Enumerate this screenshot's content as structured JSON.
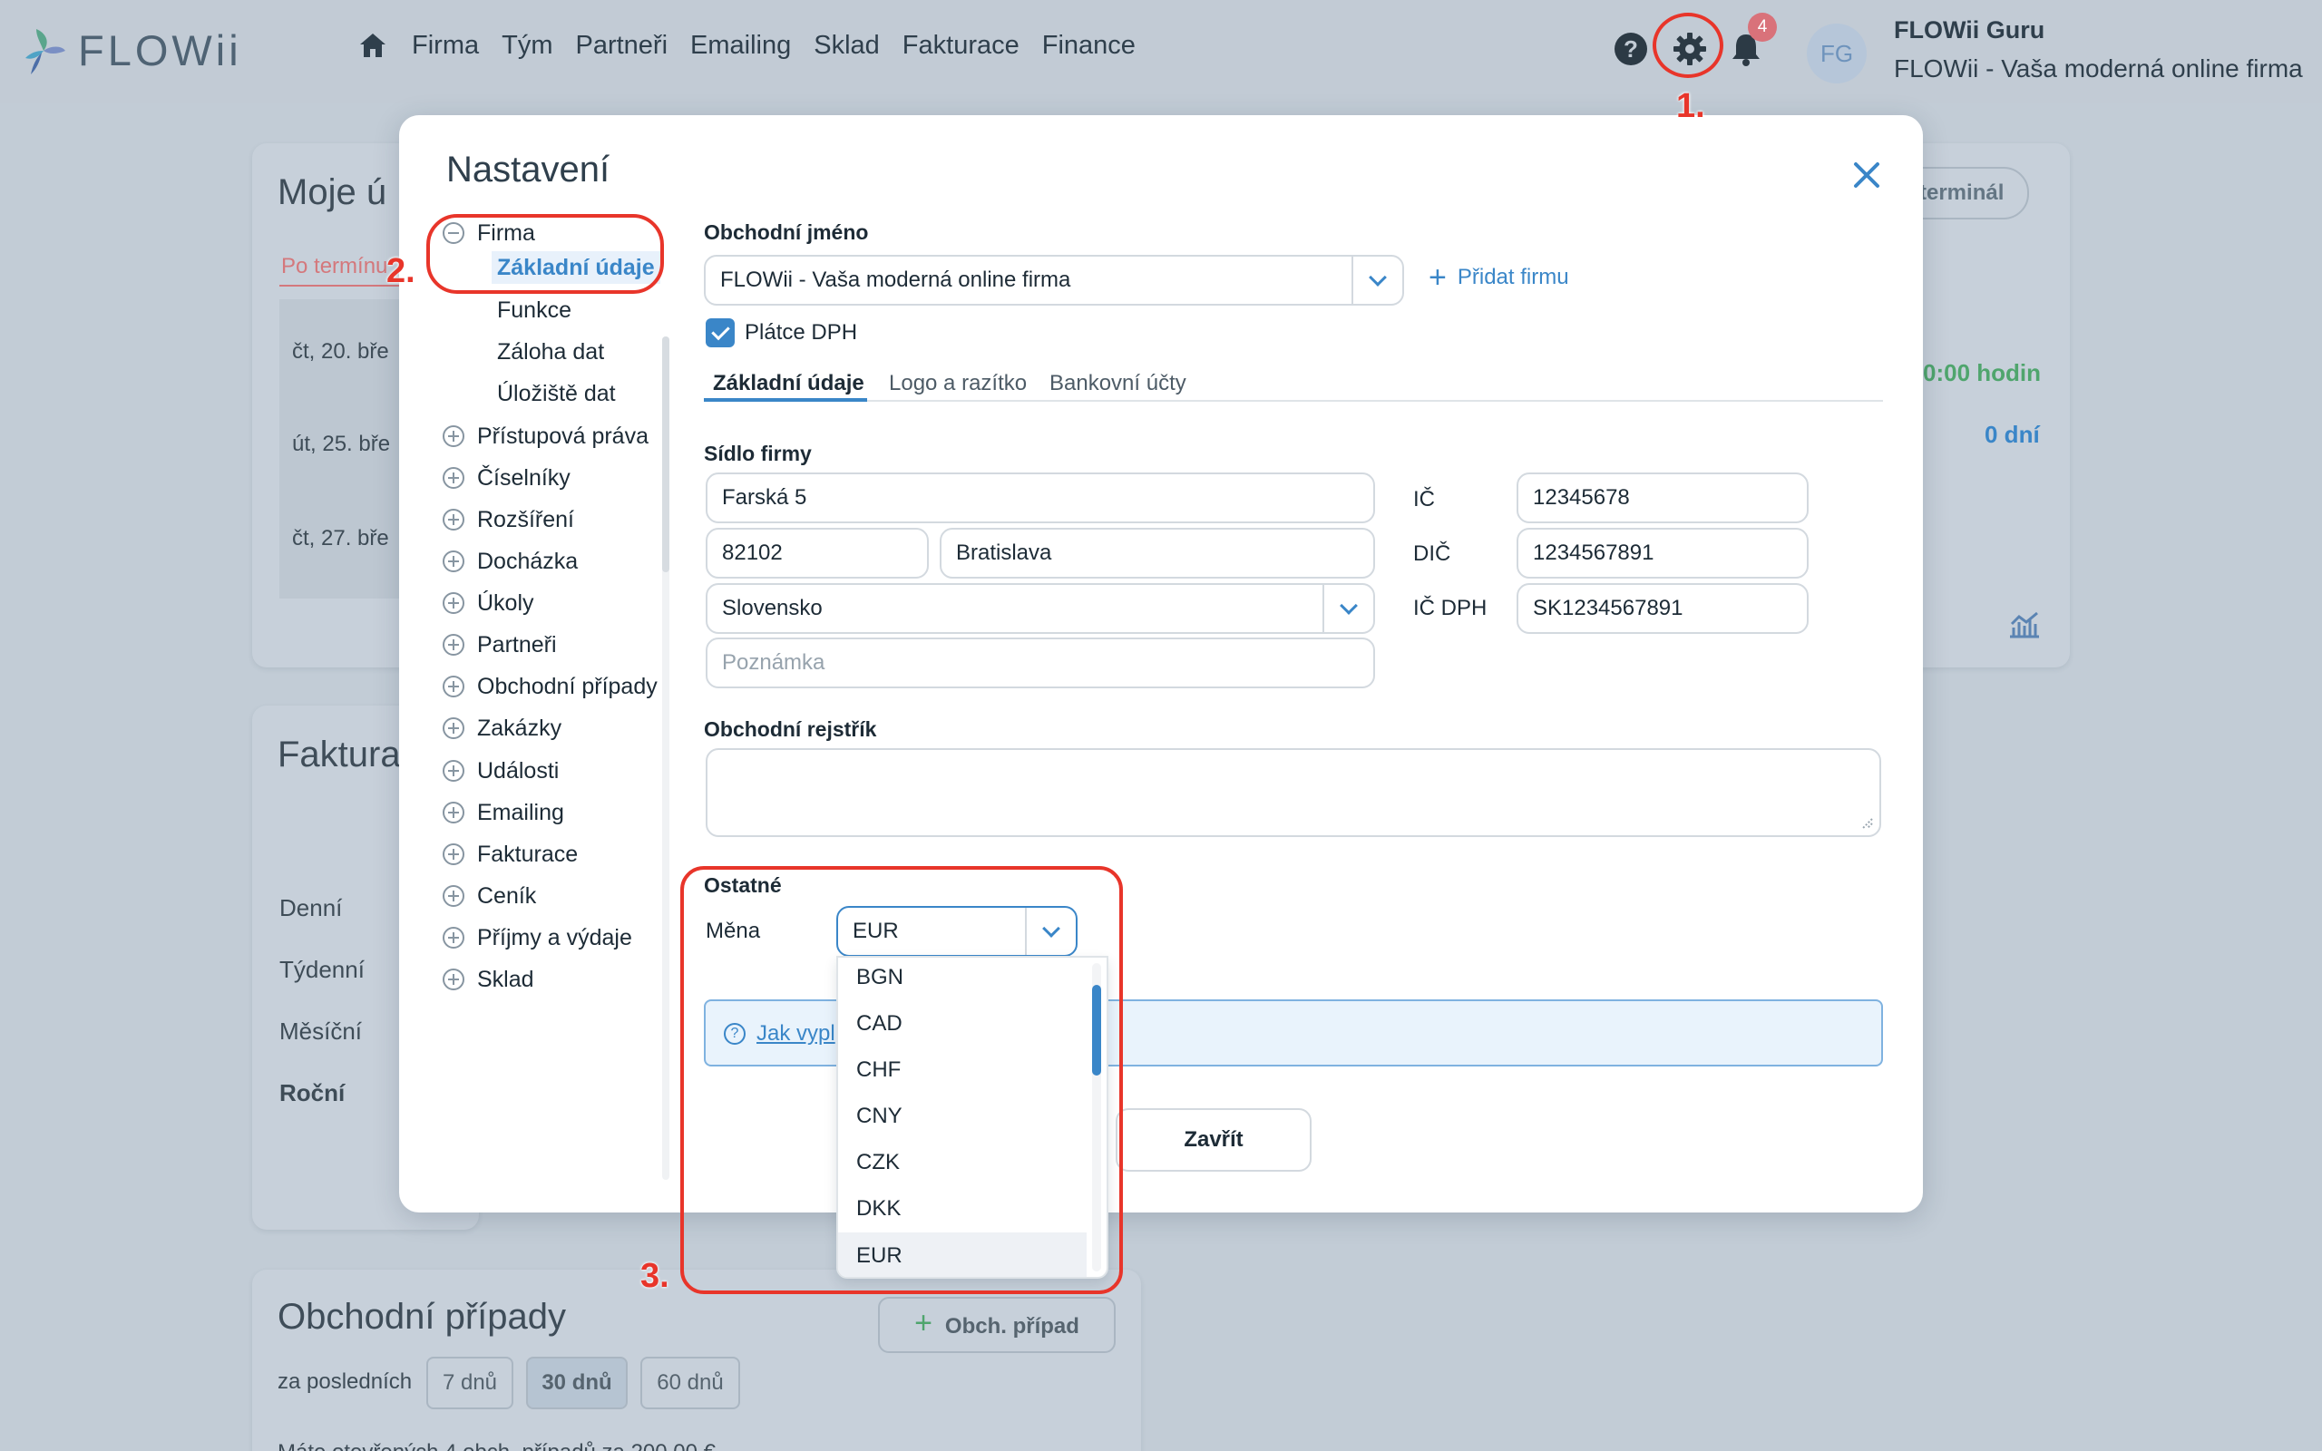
{
  "app": {
    "logo_text": "FLOWii"
  },
  "nav": {
    "items": [
      "Firma",
      "Tým",
      "Partneři",
      "Emailing",
      "Sklad",
      "Fakturace",
      "Finance"
    ]
  },
  "topbar": {
    "notifications_count": "4",
    "avatar_initials": "FG",
    "user_name": "FLOWii Guru",
    "user_company": "FLOWii - Vaša moderná online firma",
    "help_label": "?"
  },
  "background": {
    "card1_title": "Moje ú",
    "card1_filter": "Po termínu",
    "card1_rows": [
      "čt, 20. bře",
      "út, 25. bře",
      "čt, 27. bře"
    ],
    "card1_terminal": "terminál",
    "card1_hours": "0:00 hodin",
    "card1_days": "0 dní",
    "card2_title": "Faktura",
    "card2_rows": [
      "Denní",
      "Týdenní",
      "Měsíční",
      "Roční"
    ],
    "card3_title": "Obchodní případy",
    "card3_button": "Obch. případ",
    "card3_period_label": "za posledních",
    "card3_periods": [
      "7 dnů",
      "30 dnů",
      "60 dnů"
    ],
    "card3_footer": "Máte otevřených 4 obch. případů za 200,00 €"
  },
  "modal": {
    "title": "Nastavení",
    "tree": {
      "root": "Firma",
      "children": [
        "Základní údaje",
        "Funkce",
        "Záloha dat",
        "Úložiště dat"
      ],
      "sections": [
        "Přístupová práva",
        "Číselníky",
        "Rozšíření",
        "Docházka",
        "Úkoly",
        "Partneři",
        "Obchodní případy",
        "Zakázky",
        "Události",
        "Emailing",
        "Fakturace",
        "Ceník",
        "Příjmy a výdaje",
        "Sklad"
      ]
    },
    "company_label": "Obchodní jméno",
    "company_value": "FLOWii - Vaša moderná online firma",
    "add_company": "Přidat firmu",
    "vat_payer": "Plátce DPH",
    "tabs": [
      "Základní údaje",
      "Logo a razítko",
      "Bankovní účty"
    ],
    "address_label": "Sídlo firmy",
    "street": "Farská 5",
    "zip": "82102",
    "city": "Bratislava",
    "country": "Slovensko",
    "note_placeholder": "Poznámka",
    "ic_label": "IČ",
    "ic_value": "12345678",
    "dic_label": "DIČ",
    "dic_value": "1234567891",
    "icdph_label": "IČ DPH",
    "icdph_value": "SK1234567891",
    "register_label": "Obchodní rejstřík",
    "other_label": "Ostatné",
    "currency_label": "Měna",
    "currency_value": "EUR",
    "currency_options": [
      "BGN",
      "CAD",
      "CHF",
      "CNY",
      "CZK",
      "DKK",
      "EUR"
    ],
    "info_link": "Jak vypl",
    "close_button": "Zavřít"
  },
  "annotations": {
    "step1": "1.",
    "step2": "2.",
    "step3": "3.",
    "color": "#e8352a"
  },
  "colors": {
    "accent": "#3a86c8",
    "badge": "#d9727a",
    "topbar": "#c2cbd5"
  }
}
